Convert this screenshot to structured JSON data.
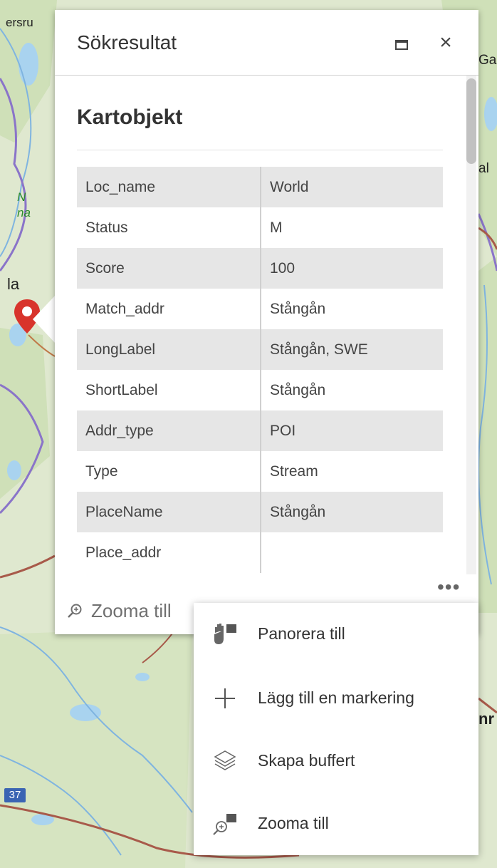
{
  "map": {
    "labels": {
      "left_top": "ersru",
      "right_top": "Ga",
      "right_mid": "al",
      "right_low": "nr",
      "left_mid": "la",
      "park_line1": "N",
      "park_line2": "na"
    },
    "road_shield": "37",
    "marker_color": "#d8342c"
  },
  "popup": {
    "title": "Sökresultat",
    "maximize_icon": "maximize-icon",
    "close_label": "×",
    "section_title": "Kartobjekt",
    "attributes": [
      {
        "key": "Loc_name",
        "value": "World"
      },
      {
        "key": "Status",
        "value": "M"
      },
      {
        "key": "Score",
        "value": "100"
      },
      {
        "key": "Match_addr",
        "value": "Stångån"
      },
      {
        "key": "LongLabel",
        "value": "Stångån, SWE"
      },
      {
        "key": "ShortLabel",
        "value": "Stångån"
      },
      {
        "key": "Addr_type",
        "value": "POI"
      },
      {
        "key": "Type",
        "value": "Stream"
      },
      {
        "key": "PlaceName",
        "value": "Stångån"
      },
      {
        "key": "Place_addr",
        "value": ""
      }
    ],
    "footer": {
      "zoom_label": "Zooma till",
      "zoom_icon": "zoom-in-icon",
      "more_label": "•••"
    }
  },
  "menu": {
    "items": [
      {
        "label": "Panorera till",
        "icon": "pan-icon"
      },
      {
        "label": "Lägg till en markering",
        "icon": "plus-icon"
      },
      {
        "label": "Skapa buffert",
        "icon": "layers-icon"
      },
      {
        "label": "Zooma till",
        "icon": "zoom-to-icon"
      }
    ]
  }
}
